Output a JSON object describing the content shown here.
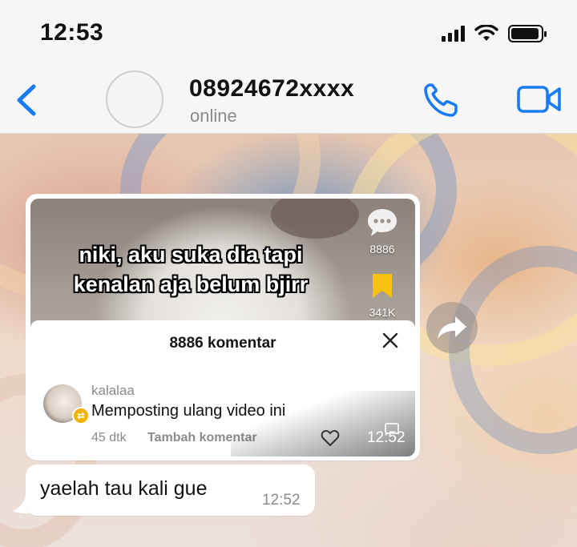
{
  "status_bar": {
    "time": "12:53"
  },
  "header": {
    "contact_name": "08924672xxxx",
    "contact_status": "online"
  },
  "icons": {
    "back": "chevron-left-icon",
    "call": "phone-icon",
    "video_call": "video-camera-icon",
    "forward": "forward-icon",
    "comments": "comment-bubble-icon",
    "bookmark": "bookmark-icon",
    "close": "close-icon",
    "like": "heart-icon"
  },
  "colors": {
    "accent": "#1a7cf5",
    "bubble": "#ffffff",
    "bookmark": "#f6c10f",
    "badge": "#f2b200"
  },
  "media_message": {
    "video_caption_line1": "niki, aku suka dia tapi",
    "video_caption_line2": "kenalan aja belum bjirr",
    "comment_count": "8886",
    "save_count": "341K",
    "panel_title": "8886 komentar",
    "comment": {
      "username": "kalalaa",
      "text": "Memposting ulang video ini",
      "age": "45 dtk",
      "add_comment": "Tambah komentar"
    },
    "timestamp": "12:52"
  },
  "text_message": {
    "text": "yaelah tau kali gue",
    "timestamp": "12:52"
  }
}
